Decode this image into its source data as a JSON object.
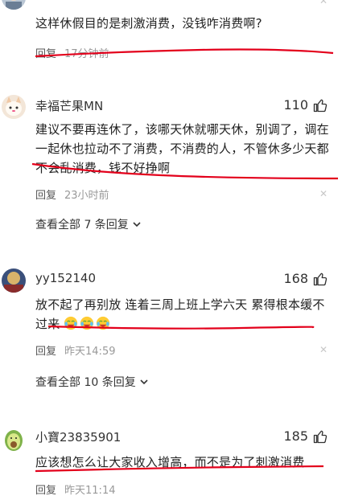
{
  "comments": [
    {
      "username": "",
      "text": "这样休假目的是刺激消费，没钱咋消费啊?",
      "reply_label": "回复",
      "time": "17分钟前"
    },
    {
      "username": "幸福芒果MN",
      "likes": "110",
      "text": "建议不要再连休了，该哪天休就哪天休，别调了，调在一起休也拉动不了消费，不消费的人，不管休多少天都不会乱消费，钱不好挣啊",
      "reply_label": "回复",
      "time": "23小时前",
      "view_replies": "查看全部 7 条回复"
    },
    {
      "username": "yy152140",
      "likes": "168",
      "text": "放不起了再别放 连着三周上班上学六天 累得根本缓不过来",
      "reply_label": "回复",
      "time": "昨天14:59",
      "view_replies": "查看全部 10 条回复"
    },
    {
      "username": "小寶23835901",
      "likes": "185",
      "text": "应该想怎么让大家收入增高，而不是为了刺激消费",
      "reply_label": "回复",
      "time": "昨天11:14"
    }
  ],
  "colors": {
    "annotation_red": "#e3001b",
    "muted": "#999999"
  },
  "icons": [
    "thumbs-up-icon",
    "close-icon",
    "chevron-down-icon",
    "crying-laughing-emoji"
  ]
}
